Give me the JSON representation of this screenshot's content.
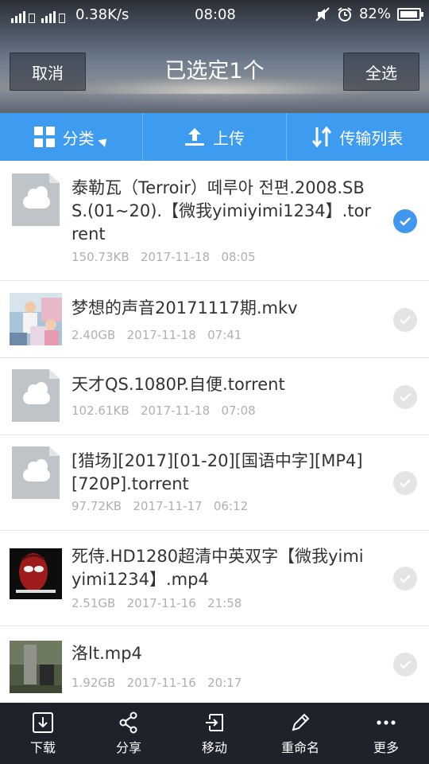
{
  "status_bar": {
    "network_speed": "0.38K/s",
    "time": "08:08",
    "battery_percent": "82%",
    "icons": [
      "signal-icon",
      "signal-4g-icon",
      "mute-icon",
      "alarm-icon",
      "battery-icon"
    ]
  },
  "header": {
    "cancel_label": "取消",
    "title": "已选定1个",
    "select_all_label": "全选"
  },
  "toolbar": {
    "category_label": "分类",
    "upload_label": "上传",
    "transfer_label": "传输列表"
  },
  "files": [
    {
      "name": "泰勒瓦（Terroir）떼루아 전편.2008.SBS.(01~20).【微我yimiyimi1234】.torrent",
      "size": "150.73KB",
      "date": "2017-11-18",
      "time": "08:05",
      "selected": true,
      "thumb": "cloud-file"
    },
    {
      "name": "梦想的声音20171117期.mkv",
      "size": "2.40GB",
      "date": "2017-11-18",
      "time": "07:41",
      "selected": false,
      "thumb": "video-frame-stage"
    },
    {
      "name": "天才QS.1080P.自便.torrent",
      "size": "102.61KB",
      "date": "2017-11-18",
      "time": "07:08",
      "selected": false,
      "thumb": "cloud-file"
    },
    {
      "name": "[猎场][2017][01-20][国语中字][MP4][720P].torrent",
      "size": "97.72KB",
      "date": "2017-11-17",
      "time": "06:12",
      "selected": false,
      "thumb": "cloud-file"
    },
    {
      "name": "死侍.HD1280超清中英双字【微我yimiyimi1234】.mp4",
      "size": "2.51GB",
      "date": "2017-11-16",
      "time": "21:58",
      "selected": false,
      "thumb": "video-frame-mask"
    },
    {
      "name": "洛lt.mp4",
      "size": "1.92GB",
      "date": "2017-11-16",
      "time": "20:17",
      "selected": false,
      "thumb": "video-frame-outdoor"
    }
  ],
  "bottom_bar": {
    "download_label": "下载",
    "share_label": "分享",
    "move_label": "移动",
    "rename_label": "重命名",
    "more_label": "更多"
  },
  "colors": {
    "toolbar_blue": "#3e9cf0",
    "check_selected": "#3f97ee",
    "bottom_bar": "#1e232b"
  }
}
